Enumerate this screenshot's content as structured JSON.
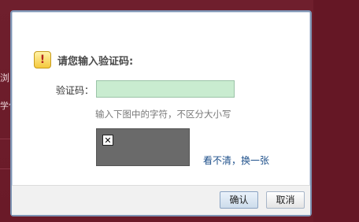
{
  "background": {
    "side_text_1": "浏",
    "side_text_2": "学位"
  },
  "dialog": {
    "title": "请您输入验证码:",
    "warning_icon_glyph": "!",
    "captcha_label": "验证码：",
    "captcha_input_value": "",
    "hint": "输入下图中的字符，不区分大小写",
    "broken_image_glyph": "✕",
    "refresh_link": "看不清，换一张",
    "confirm_button": "确认",
    "cancel_button": "取消"
  },
  "colors": {
    "page_background": "#6e1d2b",
    "input_background": "#c9ecd0",
    "link": "#1d4f8a",
    "captcha_background": "#6a6a6a"
  }
}
